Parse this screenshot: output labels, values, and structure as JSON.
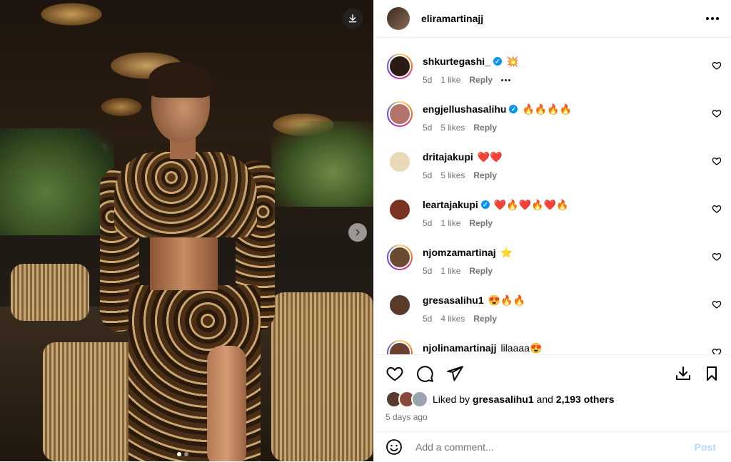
{
  "post": {
    "username": "eliramartinajj",
    "liked_by_user": "gresasalihu1",
    "liked_by_and": "and",
    "liked_by_others": "2,193 others",
    "liked_by_prefix": "Liked by",
    "time_ago": "5 days ago",
    "carousel": {
      "total": 2,
      "active": 1
    }
  },
  "comments": [
    {
      "username": "shkurtegashi_",
      "verified": true,
      "text": "💥",
      "time": "5d",
      "likes": "1 like",
      "reply": "Reply",
      "show_more": true,
      "story": true,
      "avatar_color": "#2b1b14"
    },
    {
      "username": "engjellushasalihu",
      "verified": true,
      "text": "🔥🔥🔥🔥",
      "time": "5d",
      "likes": "5 likes",
      "reply": "Reply",
      "show_more": false,
      "story": true,
      "avatar_color": "#b5746a"
    },
    {
      "username": "dritajakupi",
      "verified": false,
      "text": "❤️❤️",
      "time": "5d",
      "likes": "5 likes",
      "reply": "Reply",
      "show_more": false,
      "story": false,
      "avatar_color": "#e8d9b8"
    },
    {
      "username": "leartajakupi",
      "verified": true,
      "text": "❤️🔥❤️🔥❤️🔥",
      "time": "5d",
      "likes": "1 like",
      "reply": "Reply",
      "show_more": false,
      "story": false,
      "avatar_color": "#7a3222"
    },
    {
      "username": "njomzamartinaj",
      "verified": false,
      "text": "⭐",
      "time": "5d",
      "likes": "1 like",
      "reply": "Reply",
      "show_more": false,
      "story": true,
      "avatar_color": "#6a4a30"
    },
    {
      "username": "gresasalihu1",
      "verified": false,
      "text": "😍🔥🔥",
      "time": "5d",
      "likes": "4 likes",
      "reply": "Reply",
      "show_more": false,
      "story": false,
      "avatar_color": "#5a3a2a"
    },
    {
      "username": "njolinamartinajj",
      "verified": false,
      "text": "lilaaaa😍",
      "time": "",
      "likes": "",
      "reply": "",
      "show_more": false,
      "story": true,
      "avatar_color": "#6a4030"
    }
  ],
  "add_comment": {
    "placeholder": "Add a comment...",
    "post_label": "Post"
  },
  "icons": {
    "download": "download-icon",
    "next": "chevron-right-icon",
    "more": "more-horizontal-icon",
    "like": "heart-icon",
    "comment": "comment-icon",
    "share": "send-icon",
    "save_alt": "download-tray-icon",
    "save": "bookmark-icon",
    "emoji": "emoji-icon"
  },
  "colors": {
    "verified": "#0095f6",
    "muted": "#737373",
    "post_disabled": "#b3dbff"
  }
}
